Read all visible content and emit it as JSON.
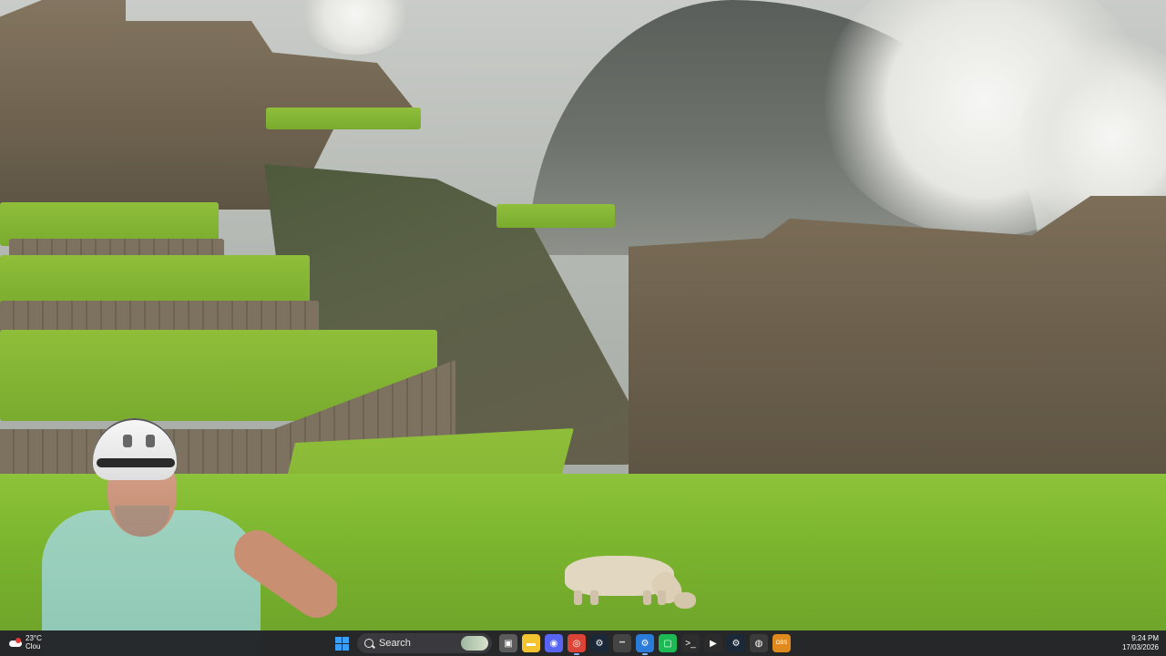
{
  "taskbar": {
    "weather": {
      "temperature": "23°C",
      "condition": "Clou"
    },
    "search": {
      "label": "Search"
    },
    "apps": [
      {
        "name": "task-view-icon",
        "glyph": "▣",
        "color": "#5b5b5b"
      },
      {
        "name": "file-explorer-icon",
        "glyph": "▬",
        "color": "#f4c430"
      },
      {
        "name": "discord-icon",
        "glyph": "◉",
        "color": "#5865f2"
      },
      {
        "name": "chrome-icon",
        "glyph": "◎",
        "color": "#db4437"
      },
      {
        "name": "steam-icon",
        "glyph": "⚙",
        "color": "#1b2838"
      },
      {
        "name": "chat-icon",
        "glyph": "•••",
        "color": "#444444"
      },
      {
        "name": "gear-app-icon",
        "glyph": "⚙",
        "color": "#2b7bd8"
      },
      {
        "name": "xbox-icon",
        "glyph": "▢",
        "color": "#1db954"
      },
      {
        "name": "terminal-icon",
        "glyph": ">_",
        "color": "#2d2d2d"
      },
      {
        "name": "play-icon",
        "glyph": "▶",
        "color": "#2b2b2b"
      },
      {
        "name": "steam-vr-icon",
        "glyph": "⚙",
        "color": "#1b2838"
      },
      {
        "name": "oculus-icon",
        "glyph": "◍",
        "color": "#3b3b3b"
      },
      {
        "name": "obs-icon",
        "glyph": "OBS",
        "color": "#e08a1e"
      }
    ],
    "clock": {
      "time": "9:24 PM",
      "date": "17/03/2026"
    }
  }
}
